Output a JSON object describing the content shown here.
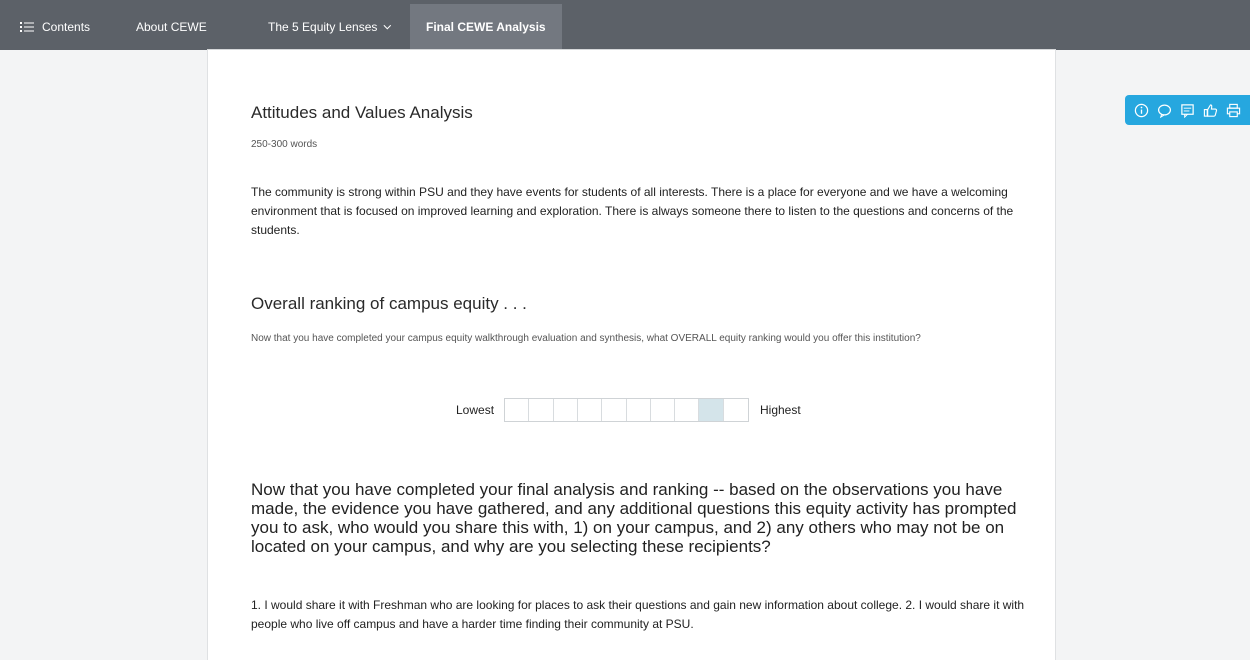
{
  "nav": {
    "contents": "Contents",
    "about": "About CEWE",
    "lenses": "The 5 Equity Lenses",
    "final": "Final CEWE Analysis"
  },
  "attitudes": {
    "heading": "Attitudes and Values Analysis",
    "word_hint": "250-300 words",
    "answer": "The community is strong within PSU and they have events for students of all interests. There is a place for everyone and we have a welcoming environment that is focused on improved learning and exploration. There is always someone there to listen to the questions and concerns of the students."
  },
  "ranking": {
    "heading": "Overall ranking of campus equity . . .",
    "prompt": "Now that you have completed your campus equity walkthrough evaluation and synthesis, what OVERALL equity ranking would you offer this institution?",
    "low_label": "Lowest",
    "high_label": "Highest",
    "scale_steps": 10,
    "selected_step": 9
  },
  "share": {
    "question": "Now that you have completed your final analysis and ranking -- based on the observations you have made, the evidence you have gathered, and any additional questions this equity activity has prompted you to ask, who would you share this with, 1) on your campus, and 2) any others who may not be on located on your campus, and why are you selecting these recipients?",
    "answer": "1. I would share it with Freshman who are looking for places to ask their questions and gain new information about college. 2. I would share it with people who live off campus and have a harder time finding their community at PSU."
  },
  "toolbar": {
    "icons": [
      "info-icon",
      "comment-icon",
      "notes-icon",
      "thumbs-up-icon",
      "print-icon"
    ],
    "color": "#26a7df"
  },
  "colors": {
    "nav_bg": "#5c6168",
    "nav_active": "#737880",
    "selected_cell": "#d4e4ea"
  }
}
